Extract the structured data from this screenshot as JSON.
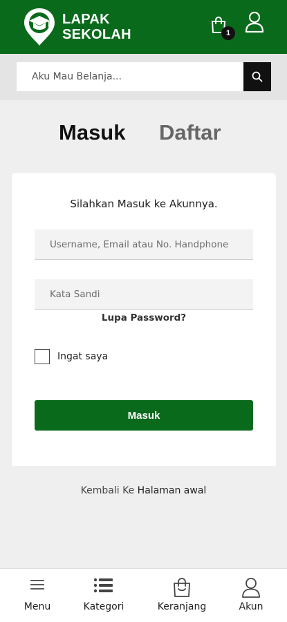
{
  "header": {
    "brand_line1": "LAPAK",
    "brand_line2": "SEKOLAH",
    "cart_count": "1",
    "logo_icon": "graduation-cap-pin-icon",
    "cart_icon": "shopping-bag-icon",
    "account_icon": "user-icon",
    "color": "#0a6a1c"
  },
  "search": {
    "placeholder": "Aku Mau Belanja...",
    "icon": "search-icon"
  },
  "tabs": {
    "login": "Masuk",
    "register": "Daftar"
  },
  "form": {
    "title": "Silahkan Masuk ke Akunnya.",
    "username_placeholder": "Username, Email atau No. Handphone",
    "password_placeholder": "Kata Sandi",
    "forgot": "Lupa Password?",
    "remember": "Ingat saya",
    "submit": "Masuk"
  },
  "back": {
    "prefix": "Kembali Ke",
    "link": "Halaman awal"
  },
  "bottom_nav": {
    "items": [
      {
        "label": "Menu",
        "icon": "hamburger-icon"
      },
      {
        "label": "Kategori",
        "icon": "list-icon"
      },
      {
        "label": "Keranjang",
        "icon": "shopping-bag-icon"
      },
      {
        "label": "Akun",
        "icon": "user-icon"
      }
    ]
  }
}
